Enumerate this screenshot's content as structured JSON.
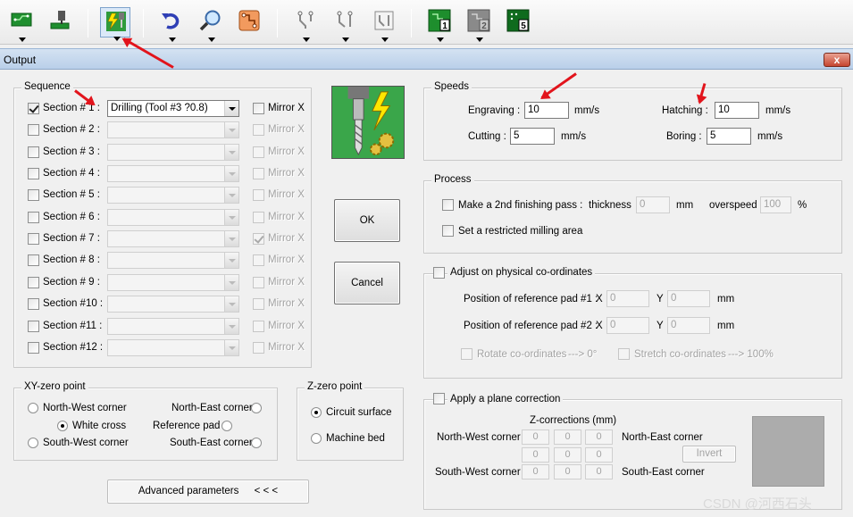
{
  "toolbar": {
    "board_icons": [
      "1",
      "2",
      "5"
    ]
  },
  "window": {
    "title": "Output",
    "close_label": "x"
  },
  "sequence": {
    "legend": "Sequence",
    "rows": [
      {
        "label": "Section # 1 :",
        "checked": true,
        "value": "Drilling (Tool #3 ?0.8)",
        "mirror": "Mirror X",
        "mirror_checked": false,
        "enabled": true
      },
      {
        "label": "Section # 2 :",
        "checked": false,
        "value": "",
        "mirror": "Mirror X",
        "mirror_checked": false,
        "enabled": false
      },
      {
        "label": "Section # 3 :",
        "checked": false,
        "value": "",
        "mirror": "Mirror X",
        "mirror_checked": false,
        "enabled": false
      },
      {
        "label": "Section # 4 :",
        "checked": false,
        "value": "",
        "mirror": "Mirror X",
        "mirror_checked": false,
        "enabled": false
      },
      {
        "label": "Section # 5 :",
        "checked": false,
        "value": "",
        "mirror": "Mirror X",
        "mirror_checked": false,
        "enabled": false
      },
      {
        "label": "Section # 6 :",
        "checked": false,
        "value": "",
        "mirror": "Mirror X",
        "mirror_checked": false,
        "enabled": false
      },
      {
        "label": "Section # 7 :",
        "checked": false,
        "value": "",
        "mirror": "Mirror X",
        "mirror_checked": true,
        "enabled": false
      },
      {
        "label": "Section # 8 :",
        "checked": false,
        "value": "",
        "mirror": "Mirror X",
        "mirror_checked": false,
        "enabled": false
      },
      {
        "label": "Section # 9 :",
        "checked": false,
        "value": "",
        "mirror": "Mirror X",
        "mirror_checked": false,
        "enabled": false
      },
      {
        "label": "Section #10 :",
        "checked": false,
        "value": "",
        "mirror": "Mirror X",
        "mirror_checked": false,
        "enabled": false
      },
      {
        "label": "Section #11 :",
        "checked": false,
        "value": "",
        "mirror": "Mirror X",
        "mirror_checked": false,
        "enabled": false
      },
      {
        "label": "Section #12 :",
        "checked": false,
        "value": "",
        "mirror": "Mirror X",
        "mirror_checked": false,
        "enabled": false
      }
    ]
  },
  "buttons": {
    "ok": "OK",
    "cancel": "Cancel",
    "advanced": "Advanced parameters",
    "advanced_arrows": "< < <",
    "invert": "Invert"
  },
  "speeds": {
    "legend": "Speeds",
    "engraving_label": "Engraving :",
    "engraving": "10",
    "hatching_label": "Hatching :",
    "hatching": "10",
    "cutting_label": "Cutting :",
    "cutting": "5",
    "boring_label": "Boring :",
    "boring": "5",
    "unit": "mm/s"
  },
  "process": {
    "legend": "Process",
    "finishing_label": "Make a 2nd finishing pass :",
    "thickness_label": "thickness",
    "thickness": "0",
    "thickness_unit": "mm",
    "overspeed_label": "overspeed",
    "overspeed": "100",
    "overspeed_unit": "%",
    "restricted_label": "Set a restricted milling area"
  },
  "adjust": {
    "legend": "Adjust on physical co-ordinates",
    "pad1_label": "Position of reference pad #1 :",
    "pad1_x": "0",
    "pad1_y": "0",
    "pad2_label": "Position of reference pad #2 :",
    "pad2_x": "0",
    "pad2_y": "0",
    "x_label": "X",
    "y_label": "Y",
    "unit": "mm",
    "rotate_label": "Rotate co-ordinates",
    "rotate_suffix": "---> 0°",
    "stretch_label": "Stretch co-ordinates",
    "stretch_suffix": "---> 100%"
  },
  "xy_zero": {
    "legend": "XY-zero point",
    "nw": "North-West corner",
    "ne": "North-East corner",
    "white_cross": "White cross",
    "reference_pad": "Reference pad",
    "sw": "South-West corner",
    "se": "South-East corner",
    "selected": "White cross"
  },
  "z_zero": {
    "legend": "Z-zero point",
    "circuit": "Circuit surface",
    "machine": "Machine bed",
    "selected": "Circuit surface"
  },
  "plane": {
    "legend": "Apply a plane correction",
    "zcorr_label": "Z-corrections (mm)",
    "nw": "North-West corner",
    "ne": "North-East corner",
    "sw": "South-West corner",
    "se": "South-East corner",
    "values": [
      "0",
      "0",
      "0",
      "0",
      "0",
      "0",
      "0",
      "0",
      "0"
    ]
  },
  "watermark": "CSDN @河西石头",
  "colors": {
    "annotation_arrow": "#e2141c",
    "title_gradient_top": "#d4e2f2"
  }
}
